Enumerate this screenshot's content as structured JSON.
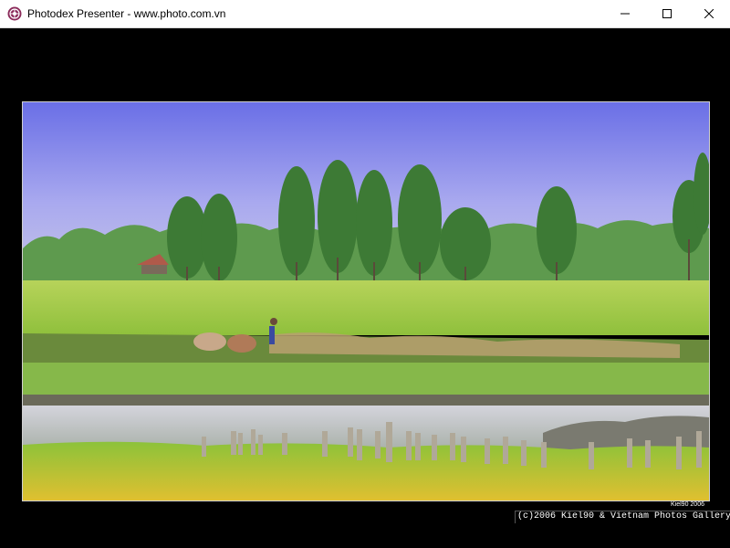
{
  "window": {
    "app_icon": "photodex-logo-icon",
    "title": "Photodex Presenter - www.photo.com.vn",
    "controls": {
      "minimize_icon": "minimize-icon",
      "maximize_icon": "maximize-icon",
      "close_icon": "close-icon"
    }
  },
  "slide": {
    "photo_description_icon": "landscape-photo",
    "signature": "Kiel90 2006",
    "copyright": "(c)2006 Kiel90 & Vietnam Photos Gallery"
  },
  "colors": {
    "titlebar_bg": "#ffffff",
    "background": "#000000",
    "app_icon": "#8b2a5a"
  }
}
